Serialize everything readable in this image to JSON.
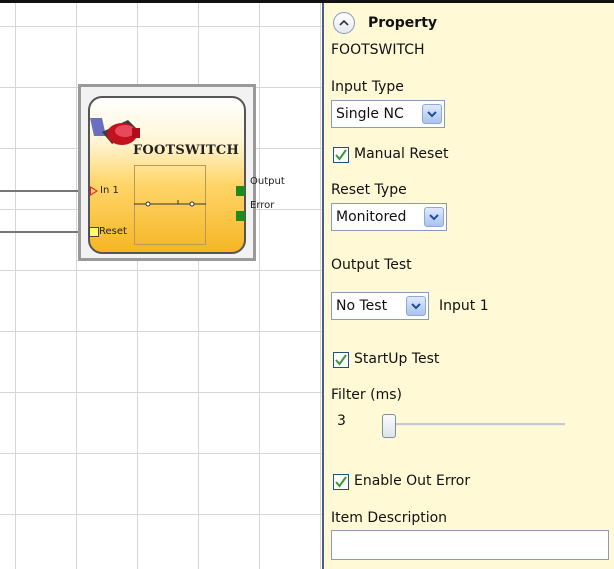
{
  "block": {
    "title": "FOOTSWITCH",
    "inputs": {
      "in1": "In 1",
      "reset": "Reset"
    },
    "outputs": {
      "output": "Output",
      "error": "Error"
    }
  },
  "property": {
    "header": "Property",
    "item_name": "FOOTSWITCH",
    "input_type": {
      "label": "Input Type",
      "value": "Single NC"
    },
    "manual_reset": {
      "label": "Manual Reset",
      "checked": true
    },
    "reset_type": {
      "label": "Reset Type",
      "value": "Monitored"
    },
    "output_test": {
      "label": "Output Test",
      "value": "No Test",
      "input_label": "Input 1"
    },
    "startup_test": {
      "label": "StartUp Test",
      "checked": true
    },
    "filter": {
      "label": "Filter (ms)",
      "value": "3"
    },
    "enable_out_error": {
      "label": "Enable Out Error",
      "checked": true
    },
    "item_description": {
      "label": "Item Description",
      "value": ""
    }
  },
  "colors": {
    "panel_bg": "#fff9d6",
    "block_gradient_bottom": "#f5b624",
    "port_green": "#1f8a1f",
    "input_arrow": "#e23",
    "checkbox_check": "#3a9a3a"
  },
  "icons": {
    "collapse": "chevron-up-icon",
    "dropdown": "chevron-down-icon",
    "checkbox": "check-icon",
    "block": "footswitch-icon"
  }
}
